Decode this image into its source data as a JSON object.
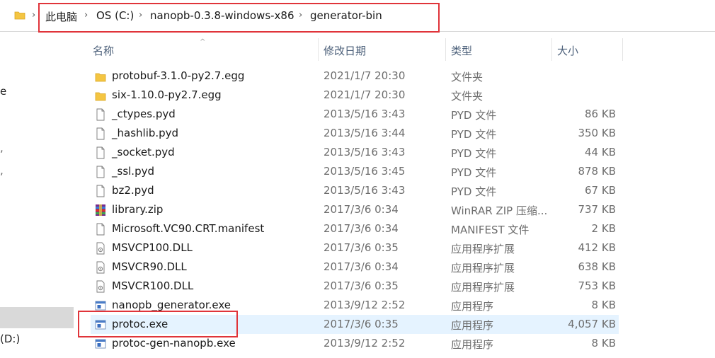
{
  "breadcrumb": [
    "此电脑",
    "OS (C:)",
    "nanopb-0.3.8-windows-x86",
    "generator-bin"
  ],
  "nav_pane": {
    "fragments": [
      "e",
      "(D:)"
    ]
  },
  "columns": {
    "name": "名称",
    "date": "修改日期",
    "type": "类型",
    "size": "大小"
  },
  "files": [
    {
      "name": "protobuf-3.1.0-py2.7.egg",
      "date": "2021/1/7 20:30",
      "type": "文件夹",
      "size": "",
      "icon": "folder-icon"
    },
    {
      "name": "six-1.10.0-py2.7.egg",
      "date": "2021/1/7 20:30",
      "type": "文件夹",
      "size": "",
      "icon": "folder-icon"
    },
    {
      "name": "_ctypes.pyd",
      "date": "2013/5/16 3:43",
      "type": "PYD 文件",
      "size": "86 KB",
      "icon": "file-icon"
    },
    {
      "name": "_hashlib.pyd",
      "date": "2013/5/16 3:44",
      "type": "PYD 文件",
      "size": "350 KB",
      "icon": "file-icon"
    },
    {
      "name": "_socket.pyd",
      "date": "2013/5/16 3:43",
      "type": "PYD 文件",
      "size": "44 KB",
      "icon": "file-icon"
    },
    {
      "name": "_ssl.pyd",
      "date": "2013/5/16 3:45",
      "type": "PYD 文件",
      "size": "878 KB",
      "icon": "file-icon"
    },
    {
      "name": "bz2.pyd",
      "date": "2013/5/16 3:43",
      "type": "PYD 文件",
      "size": "67 KB",
      "icon": "file-icon"
    },
    {
      "name": "library.zip",
      "date": "2017/3/6 0:34",
      "type": "WinRAR ZIP 压缩...",
      "size": "737 KB",
      "icon": "winrar-icon"
    },
    {
      "name": "Microsoft.VC90.CRT.manifest",
      "date": "2017/3/6 0:34",
      "type": "MANIFEST 文件",
      "size": "2 KB",
      "icon": "file-icon"
    },
    {
      "name": "MSVCP100.DLL",
      "date": "2017/3/6 0:35",
      "type": "应用程序扩展",
      "size": "412 KB",
      "icon": "dll-icon"
    },
    {
      "name": "MSVCR90.DLL",
      "date": "2017/3/6 0:34",
      "type": "应用程序扩展",
      "size": "638 KB",
      "icon": "dll-icon"
    },
    {
      "name": "MSVCR100.DLL",
      "date": "2017/3/6 0:35",
      "type": "应用程序扩展",
      "size": "753 KB",
      "icon": "dll-icon"
    },
    {
      "name": "nanopb_generator.exe",
      "date": "2013/9/12 2:52",
      "type": "应用程序",
      "size": "8 KB",
      "icon": "exe-icon"
    },
    {
      "name": "protoc.exe",
      "date": "2017/3/6 0:35",
      "type": "应用程序",
      "size": "4,057 KB",
      "icon": "exe-icon",
      "hovered": true
    },
    {
      "name": "protoc-gen-nanopb.exe",
      "date": "2013/9/12 2:52",
      "type": "应用程序",
      "size": "8 KB",
      "icon": "exe-icon"
    }
  ],
  "colors": {
    "annotation_red": "#e0343a",
    "hover_row": "#e5f3ff",
    "header_text": "#4c607a",
    "folder": "#f4c542"
  }
}
